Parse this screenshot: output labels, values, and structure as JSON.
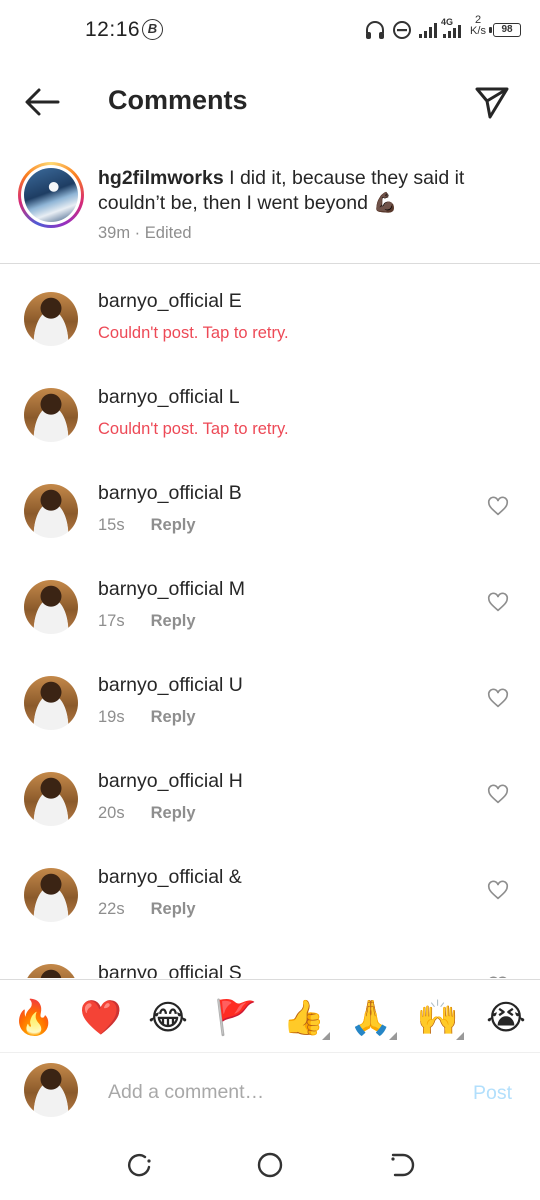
{
  "status_bar": {
    "time": "12:16",
    "badge": "B",
    "network": "4G",
    "speed_value": "2",
    "speed_unit": "K/s",
    "battery": "98"
  },
  "header": {
    "title": "Comments",
    "back_icon": "arrow-left-icon",
    "share_icon": "paper-plane-icon"
  },
  "caption": {
    "username": "hg2filmworks",
    "text": " I did it, because they said it couldn’t be, then I went beyond 💪🏿",
    "meta": "39m · Edited"
  },
  "comments": [
    {
      "username": "barnyo_official",
      "text": " E",
      "status": "Couldn't post. Tap to retry.",
      "failed": true
    },
    {
      "username": "barnyo_official",
      "text": " L",
      "status": "Couldn't post. Tap to retry.",
      "failed": true
    },
    {
      "username": "barnyo_official",
      "text": " B",
      "time": "15s",
      "reply": "Reply",
      "failed": false
    },
    {
      "username": "barnyo_official",
      "text": " M",
      "time": "17s",
      "reply": "Reply",
      "failed": false
    },
    {
      "username": "barnyo_official",
      "text": " U",
      "time": "19s",
      "reply": "Reply",
      "failed": false
    },
    {
      "username": "barnyo_official",
      "text": " H",
      "time": "20s",
      "reply": "Reply",
      "failed": false
    },
    {
      "username": "barnyo_official",
      "text": " &",
      "time": "22s",
      "reply": "Reply",
      "failed": false
    },
    {
      "username": "barnyo_official",
      "text": " S",
      "time": "",
      "reply": "",
      "failed": false
    }
  ],
  "emoji_bar": {
    "emojis": [
      "🔥",
      "❤️",
      "😂",
      "🚩",
      "👍",
      "🙏",
      "🙌",
      "😭"
    ]
  },
  "add_comment": {
    "placeholder": "Add a comment…",
    "post_label": "Post"
  },
  "colors": {
    "error": "#ed4956",
    "muted": "#8e8e8e",
    "post_disabled": "#b2dffc",
    "text": "#262626"
  }
}
